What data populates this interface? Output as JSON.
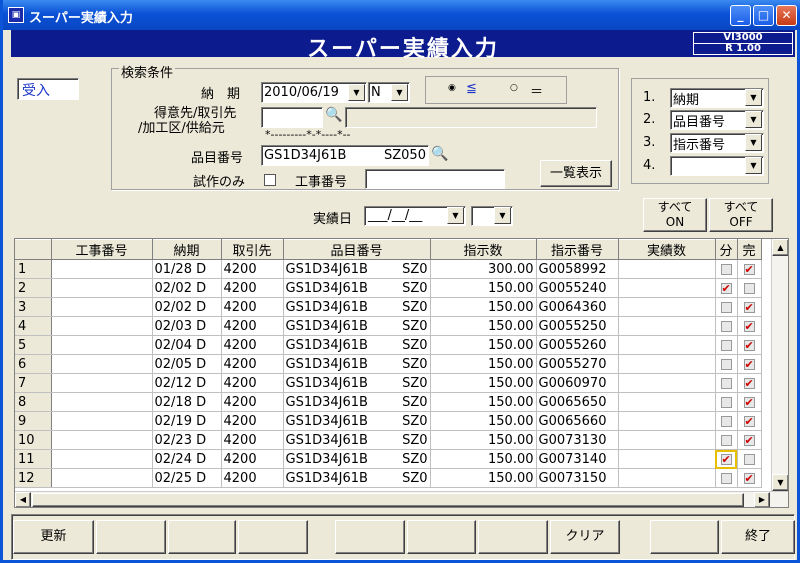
{
  "window": {
    "title": "スーパー実績入力"
  },
  "banner": {
    "title": "スーパー実績入力",
    "version": "VI3000",
    "release": "R 1.00"
  },
  "mode_label": "受入",
  "search": {
    "group_label": "検索条件",
    "nouki_label": "納　期",
    "nouki_date": "2010/06/19",
    "nouki_type": "N",
    "radio_le": "≦",
    "radio_eq": "＝",
    "customer_label_1": "得意先/取引先",
    "customer_label_2": "/加工区/供給元",
    "customer_value": "",
    "mask": "*---------*-*----*--",
    "item_label": "品目番号",
    "item_value": "GS1D34J61B",
    "item_suffix": "SZ050",
    "trial_label": "試作のみ",
    "koji_label": "工事番号",
    "koji_value": "",
    "list_button": "一覧表示",
    "jisseki_label": "実績日",
    "jisseki_value": "___/__/__"
  },
  "sort": {
    "items": [
      {
        "num": "1.",
        "value": "納期"
      },
      {
        "num": "2.",
        "value": "品目番号"
      },
      {
        "num": "3.",
        "value": "指示番号"
      },
      {
        "num": "4.",
        "value": ""
      }
    ]
  },
  "all_on": {
    "line1": "すべて",
    "line2": "ON"
  },
  "all_off": {
    "line1": "すべて",
    "line2": "OFF"
  },
  "grid": {
    "headers": [
      "工事番号",
      "納期",
      "取引先",
      "品目番号",
      "指示数",
      "指示番号",
      "実績数",
      "分",
      "完"
    ],
    "rows": [
      {
        "n": "1",
        "koji": "",
        "nouki": "01/28 D",
        "tori": "4200",
        "hinmoku": "GS1D34J61B",
        "sz": "SZ0",
        "shiji": "300.00",
        "shijino": "G0058992",
        "jisseki": "",
        "bun": false,
        "kan": true
      },
      {
        "n": "2",
        "koji": "",
        "nouki": "02/02 D",
        "tori": "4200",
        "hinmoku": "GS1D34J61B",
        "sz": "SZ0",
        "shiji": "150.00",
        "shijino": "G0055240",
        "jisseki": "",
        "bun": true,
        "kan": false
      },
      {
        "n": "3",
        "koji": "",
        "nouki": "02/02 D",
        "tori": "4200",
        "hinmoku": "GS1D34J61B",
        "sz": "SZ0",
        "shiji": "150.00",
        "shijino": "G0064360",
        "jisseki": "",
        "bun": false,
        "kan": true
      },
      {
        "n": "4",
        "koji": "",
        "nouki": "02/03 D",
        "tori": "4200",
        "hinmoku": "GS1D34J61B",
        "sz": "SZ0",
        "shiji": "150.00",
        "shijino": "G0055250",
        "jisseki": "",
        "bun": false,
        "kan": true
      },
      {
        "n": "5",
        "koji": "",
        "nouki": "02/04 D",
        "tori": "4200",
        "hinmoku": "GS1D34J61B",
        "sz": "SZ0",
        "shiji": "150.00",
        "shijino": "G0055260",
        "jisseki": "",
        "bun": false,
        "kan": true
      },
      {
        "n": "6",
        "koji": "",
        "nouki": "02/05 D",
        "tori": "4200",
        "hinmoku": "GS1D34J61B",
        "sz": "SZ0",
        "shiji": "150.00",
        "shijino": "G0055270",
        "jisseki": "",
        "bun": false,
        "kan": true
      },
      {
        "n": "7",
        "koji": "",
        "nouki": "02/12 D",
        "tori": "4200",
        "hinmoku": "GS1D34J61B",
        "sz": "SZ0",
        "shiji": "150.00",
        "shijino": "G0060970",
        "jisseki": "",
        "bun": false,
        "kan": true
      },
      {
        "n": "8",
        "koji": "",
        "nouki": "02/18 D",
        "tori": "4200",
        "hinmoku": "GS1D34J61B",
        "sz": "SZ0",
        "shiji": "150.00",
        "shijino": "G0065650",
        "jisseki": "",
        "bun": false,
        "kan": true
      },
      {
        "n": "9",
        "koji": "",
        "nouki": "02/19 D",
        "tori": "4200",
        "hinmoku": "GS1D34J61B",
        "sz": "SZ0",
        "shiji": "150.00",
        "shijino": "G0065660",
        "jisseki": "",
        "bun": false,
        "kan": true
      },
      {
        "n": "10",
        "koji": "",
        "nouki": "02/23 D",
        "tori": "4200",
        "hinmoku": "GS1D34J61B",
        "sz": "SZ0",
        "shiji": "150.00",
        "shijino": "G0073130",
        "jisseki": "",
        "bun": false,
        "kan": true
      },
      {
        "n": "11",
        "koji": "",
        "nouki": "02/24 D",
        "tori": "4200",
        "hinmoku": "GS1D34J61B",
        "sz": "SZ0",
        "shiji": "150.00",
        "shijino": "G0073140",
        "jisseki": "",
        "bun": true,
        "kan": false
      },
      {
        "n": "12",
        "koji": "",
        "nouki": "02/25 D",
        "tori": "4200",
        "hinmoku": "GS1D34J61B",
        "sz": "SZ0",
        "shiji": "150.00",
        "shijino": "G0073150",
        "jisseki": "",
        "bun": false,
        "kan": true
      }
    ]
  },
  "footer": {
    "buttons": [
      "更新",
      "",
      "",
      "",
      "",
      "",
      "",
      "クリア",
      "",
      "終了"
    ]
  },
  "colors": {
    "title": "#0a52d6",
    "banner": "#0c1b8e",
    "face": "#ece9d8",
    "check": "#cc0000"
  }
}
